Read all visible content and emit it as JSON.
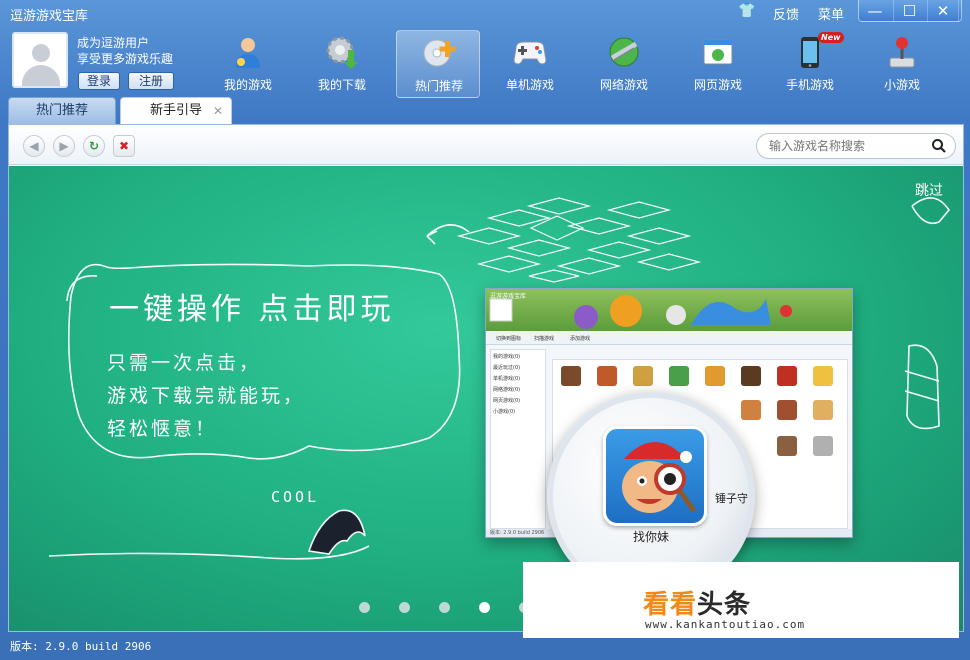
{
  "window": {
    "title": "逗游游戏宝库",
    "links": {
      "feedback": "反馈",
      "menu": "菜单"
    },
    "controls": {
      "minimize": "—",
      "maximize": "☐",
      "close": "✕"
    }
  },
  "user": {
    "line1": "成为逗游用户",
    "line2": "享受更多游戏乐趣",
    "login": "登录",
    "register": "注册"
  },
  "nav": [
    {
      "label": "我的游戏",
      "icon": "user-games-icon"
    },
    {
      "label": "我的下载",
      "icon": "download-gear-icon"
    },
    {
      "label": "热门推荐",
      "icon": "cd-plus-icon",
      "active": true
    },
    {
      "label": "单机游戏",
      "icon": "gamepad-icon"
    },
    {
      "label": "网络游戏",
      "icon": "globe-icon"
    },
    {
      "label": "网页游戏",
      "icon": "web-game-icon"
    },
    {
      "label": "手机游戏",
      "icon": "mobile-icon",
      "badge": "New"
    },
    {
      "label": "小游戏",
      "icon": "joystick-icon"
    }
  ],
  "tabs": [
    {
      "label": "热门推荐"
    },
    {
      "label": "新手引导",
      "active": true,
      "close": "✕"
    }
  ],
  "toolbar": {
    "back": "◀",
    "forward": "▶",
    "refresh": "↻",
    "stop": "✖",
    "search_placeholder": "输入游戏名称搜索"
  },
  "banner": {
    "title": "一键操作 点击即玩",
    "lines": [
      "只需一次点击，",
      "游戏下载完就能玩，",
      "轻松惬意！"
    ],
    "skip": "跳过",
    "cool": "COOL",
    "mini": {
      "title": "逗游游戏宝库",
      "toolbar_items": [
        "切换到图标",
        "扫描游戏",
        "添加游戏"
      ],
      "sidebar": [
        "我的游戏(0)",
        "最近玩过(0)",
        "单机游戏(0)",
        "网络游戏(0)",
        "网页游戏(0)",
        "小游戏(0)"
      ],
      "footer": "版本: 2.9.0 build 2906"
    },
    "magnifier": {
      "game": "找你妹",
      "game2": "锤子守"
    },
    "pages": 5,
    "active_page": 4
  },
  "watermark": {
    "brand_part1": "看看",
    "brand_part2": "头条",
    "url": "www.kankantoutiao.com"
  },
  "status": {
    "version": "版本: 2.9.0 build 2906"
  },
  "colors": {
    "banner": "#1fae80",
    "brand_orange": "#f08a1c",
    "frame_blue": "#3f78c4"
  }
}
